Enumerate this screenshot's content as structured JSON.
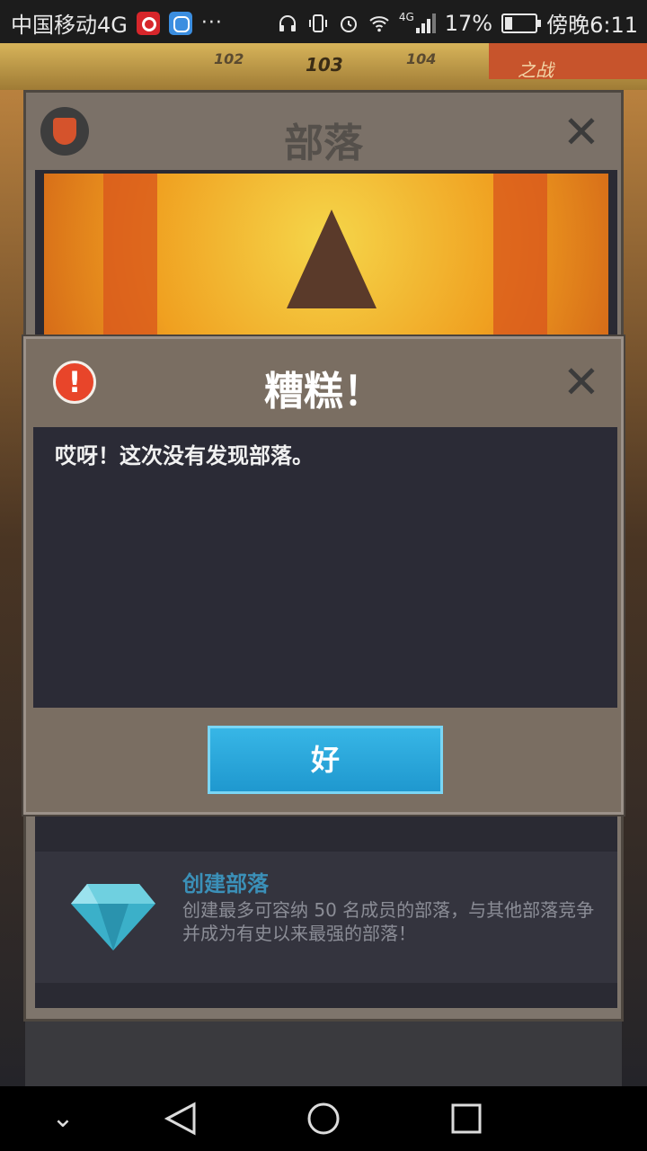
{
  "status_bar": {
    "carrier": "中国移动4G",
    "dots": "···",
    "network": "4G",
    "battery_percent": "17%",
    "time": "傍晚6:11"
  },
  "game_bg": {
    "levels": [
      "102",
      "103",
      "104"
    ],
    "event_label": "之战"
  },
  "tribe_panel": {
    "title": "部落",
    "create": {
      "title": "创建部落",
      "description": "创建最多可容纳 50 名成员的部落，与其他部落竞争并成为有史以来最强的部落！"
    }
  },
  "dialog": {
    "title": "糟糕！",
    "message": "哎呀！这次没有发现部落。",
    "ok_label": "好"
  },
  "colors": {
    "accent_button": "#1f98cf",
    "warning": "#e8452a",
    "panel": "#7a6e62"
  }
}
